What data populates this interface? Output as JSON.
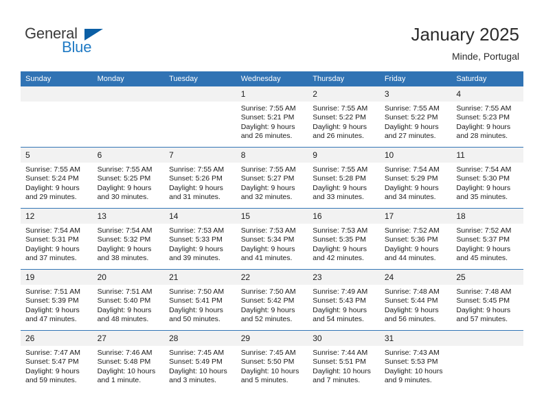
{
  "branding": {
    "logo_word_1": "General",
    "logo_word_2": "Blue",
    "logo_triangle": "triangle-icon"
  },
  "header": {
    "title": "January 2025",
    "subtitle": "Minde, Portugal"
  },
  "colors": {
    "header_blue": "#3073b4",
    "logo_blue": "#1f7ac4",
    "logo_triangle_blue": "#0b5fa5",
    "daynum_background": "#f2f2f2",
    "text": "#1a1a1a"
  },
  "weekdays": [
    "Sunday",
    "Monday",
    "Tuesday",
    "Wednesday",
    "Thursday",
    "Friday",
    "Saturday"
  ],
  "weeks": [
    [
      {
        "day": "",
        "empty": true
      },
      {
        "day": "",
        "empty": true
      },
      {
        "day": "",
        "empty": true
      },
      {
        "day": "1",
        "sunrise": "Sunrise: 7:55 AM",
        "sunset": "Sunset: 5:21 PM",
        "daylight_1": "Daylight: 9 hours",
        "daylight_2": "and 26 minutes."
      },
      {
        "day": "2",
        "sunrise": "Sunrise: 7:55 AM",
        "sunset": "Sunset: 5:22 PM",
        "daylight_1": "Daylight: 9 hours",
        "daylight_2": "and 26 minutes."
      },
      {
        "day": "3",
        "sunrise": "Sunrise: 7:55 AM",
        "sunset": "Sunset: 5:22 PM",
        "daylight_1": "Daylight: 9 hours",
        "daylight_2": "and 27 minutes."
      },
      {
        "day": "4",
        "sunrise": "Sunrise: 7:55 AM",
        "sunset": "Sunset: 5:23 PM",
        "daylight_1": "Daylight: 9 hours",
        "daylight_2": "and 28 minutes."
      }
    ],
    [
      {
        "day": "5",
        "sunrise": "Sunrise: 7:55 AM",
        "sunset": "Sunset: 5:24 PM",
        "daylight_1": "Daylight: 9 hours",
        "daylight_2": "and 29 minutes."
      },
      {
        "day": "6",
        "sunrise": "Sunrise: 7:55 AM",
        "sunset": "Sunset: 5:25 PM",
        "daylight_1": "Daylight: 9 hours",
        "daylight_2": "and 30 minutes."
      },
      {
        "day": "7",
        "sunrise": "Sunrise: 7:55 AM",
        "sunset": "Sunset: 5:26 PM",
        "daylight_1": "Daylight: 9 hours",
        "daylight_2": "and 31 minutes."
      },
      {
        "day": "8",
        "sunrise": "Sunrise: 7:55 AM",
        "sunset": "Sunset: 5:27 PM",
        "daylight_1": "Daylight: 9 hours",
        "daylight_2": "and 32 minutes."
      },
      {
        "day": "9",
        "sunrise": "Sunrise: 7:55 AM",
        "sunset": "Sunset: 5:28 PM",
        "daylight_1": "Daylight: 9 hours",
        "daylight_2": "and 33 minutes."
      },
      {
        "day": "10",
        "sunrise": "Sunrise: 7:54 AM",
        "sunset": "Sunset: 5:29 PM",
        "daylight_1": "Daylight: 9 hours",
        "daylight_2": "and 34 minutes."
      },
      {
        "day": "11",
        "sunrise": "Sunrise: 7:54 AM",
        "sunset": "Sunset: 5:30 PM",
        "daylight_1": "Daylight: 9 hours",
        "daylight_2": "and 35 minutes."
      }
    ],
    [
      {
        "day": "12",
        "sunrise": "Sunrise: 7:54 AM",
        "sunset": "Sunset: 5:31 PM",
        "daylight_1": "Daylight: 9 hours",
        "daylight_2": "and 37 minutes."
      },
      {
        "day": "13",
        "sunrise": "Sunrise: 7:54 AM",
        "sunset": "Sunset: 5:32 PM",
        "daylight_1": "Daylight: 9 hours",
        "daylight_2": "and 38 minutes."
      },
      {
        "day": "14",
        "sunrise": "Sunrise: 7:53 AM",
        "sunset": "Sunset: 5:33 PM",
        "daylight_1": "Daylight: 9 hours",
        "daylight_2": "and 39 minutes."
      },
      {
        "day": "15",
        "sunrise": "Sunrise: 7:53 AM",
        "sunset": "Sunset: 5:34 PM",
        "daylight_1": "Daylight: 9 hours",
        "daylight_2": "and 41 minutes."
      },
      {
        "day": "16",
        "sunrise": "Sunrise: 7:53 AM",
        "sunset": "Sunset: 5:35 PM",
        "daylight_1": "Daylight: 9 hours",
        "daylight_2": "and 42 minutes."
      },
      {
        "day": "17",
        "sunrise": "Sunrise: 7:52 AM",
        "sunset": "Sunset: 5:36 PM",
        "daylight_1": "Daylight: 9 hours",
        "daylight_2": "and 44 minutes."
      },
      {
        "day": "18",
        "sunrise": "Sunrise: 7:52 AM",
        "sunset": "Sunset: 5:37 PM",
        "daylight_1": "Daylight: 9 hours",
        "daylight_2": "and 45 minutes."
      }
    ],
    [
      {
        "day": "19",
        "sunrise": "Sunrise: 7:51 AM",
        "sunset": "Sunset: 5:39 PM",
        "daylight_1": "Daylight: 9 hours",
        "daylight_2": "and 47 minutes."
      },
      {
        "day": "20",
        "sunrise": "Sunrise: 7:51 AM",
        "sunset": "Sunset: 5:40 PM",
        "daylight_1": "Daylight: 9 hours",
        "daylight_2": "and 48 minutes."
      },
      {
        "day": "21",
        "sunrise": "Sunrise: 7:50 AM",
        "sunset": "Sunset: 5:41 PM",
        "daylight_1": "Daylight: 9 hours",
        "daylight_2": "and 50 minutes."
      },
      {
        "day": "22",
        "sunrise": "Sunrise: 7:50 AM",
        "sunset": "Sunset: 5:42 PM",
        "daylight_1": "Daylight: 9 hours",
        "daylight_2": "and 52 minutes."
      },
      {
        "day": "23",
        "sunrise": "Sunrise: 7:49 AM",
        "sunset": "Sunset: 5:43 PM",
        "daylight_1": "Daylight: 9 hours",
        "daylight_2": "and 54 minutes."
      },
      {
        "day": "24",
        "sunrise": "Sunrise: 7:48 AM",
        "sunset": "Sunset: 5:44 PM",
        "daylight_1": "Daylight: 9 hours",
        "daylight_2": "and 56 minutes."
      },
      {
        "day": "25",
        "sunrise": "Sunrise: 7:48 AM",
        "sunset": "Sunset: 5:45 PM",
        "daylight_1": "Daylight: 9 hours",
        "daylight_2": "and 57 minutes."
      }
    ],
    [
      {
        "day": "26",
        "sunrise": "Sunrise: 7:47 AM",
        "sunset": "Sunset: 5:47 PM",
        "daylight_1": "Daylight: 9 hours",
        "daylight_2": "and 59 minutes."
      },
      {
        "day": "27",
        "sunrise": "Sunrise: 7:46 AM",
        "sunset": "Sunset: 5:48 PM",
        "daylight_1": "Daylight: 10 hours",
        "daylight_2": "and 1 minute."
      },
      {
        "day": "28",
        "sunrise": "Sunrise: 7:45 AM",
        "sunset": "Sunset: 5:49 PM",
        "daylight_1": "Daylight: 10 hours",
        "daylight_2": "and 3 minutes."
      },
      {
        "day": "29",
        "sunrise": "Sunrise: 7:45 AM",
        "sunset": "Sunset: 5:50 PM",
        "daylight_1": "Daylight: 10 hours",
        "daylight_2": "and 5 minutes."
      },
      {
        "day": "30",
        "sunrise": "Sunrise: 7:44 AM",
        "sunset": "Sunset: 5:51 PM",
        "daylight_1": "Daylight: 10 hours",
        "daylight_2": "and 7 minutes."
      },
      {
        "day": "31",
        "sunrise": "Sunrise: 7:43 AM",
        "sunset": "Sunset: 5:53 PM",
        "daylight_1": "Daylight: 10 hours",
        "daylight_2": "and 9 minutes."
      },
      {
        "day": "",
        "empty": true
      }
    ]
  ]
}
